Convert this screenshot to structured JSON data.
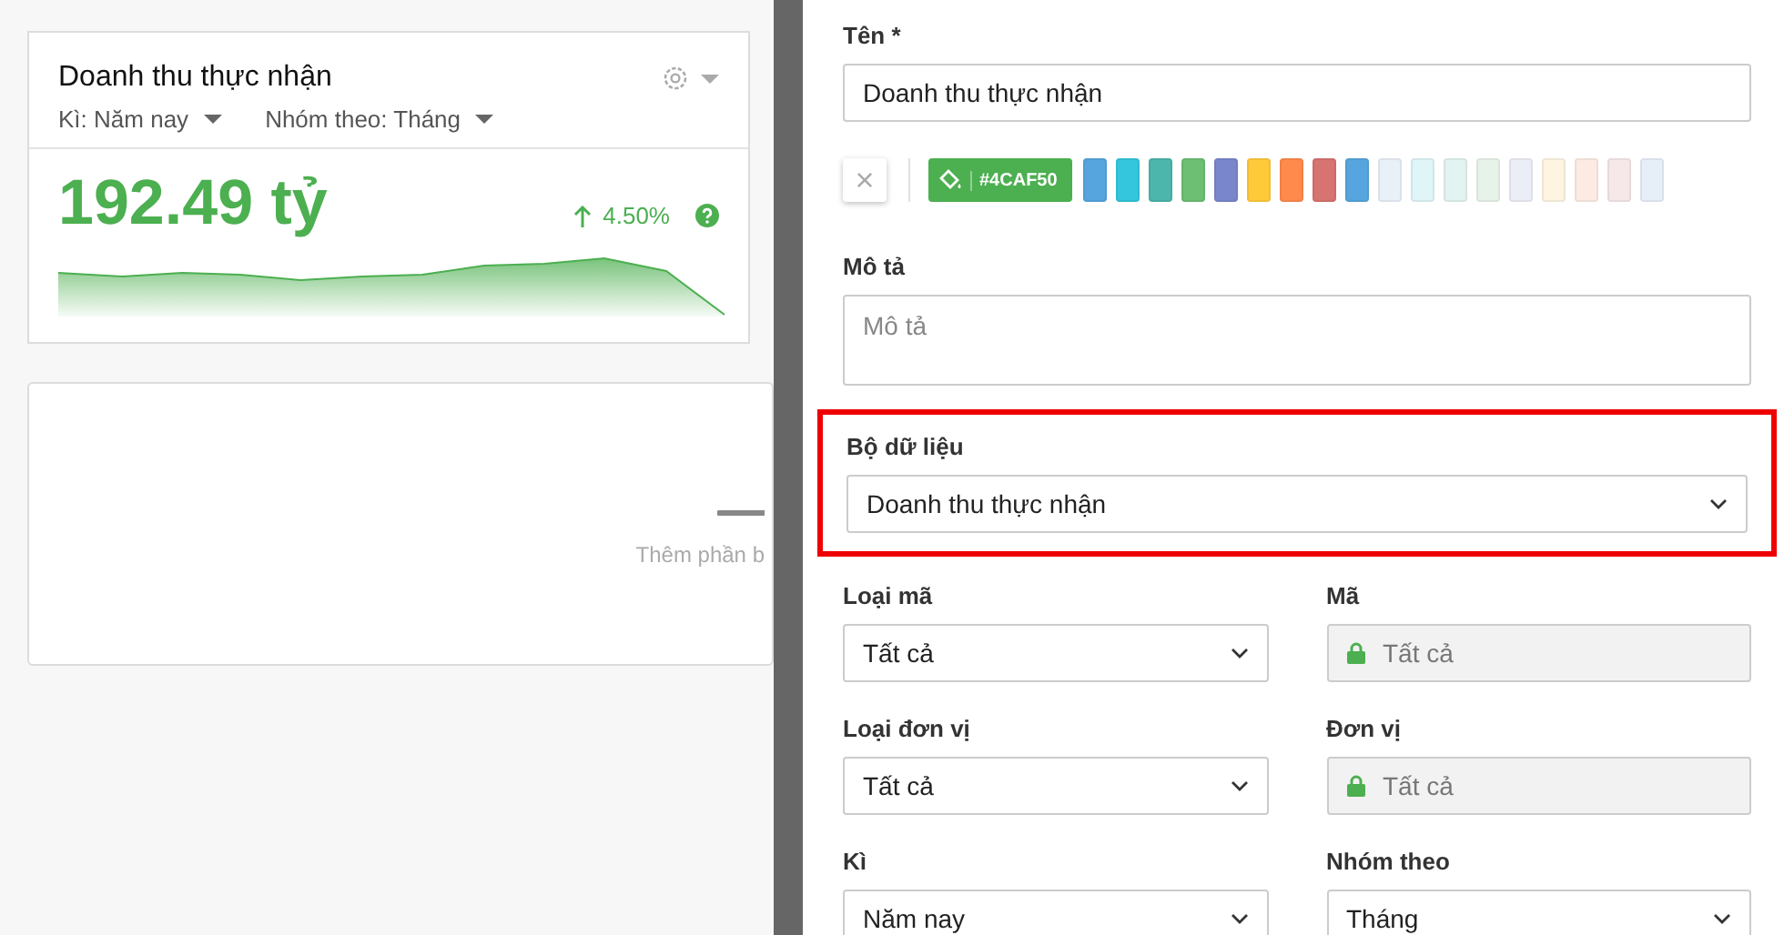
{
  "widget": {
    "title": "Doanh thu thực nhận",
    "filters": [
      {
        "label": "Kì:",
        "value": "Năm nay"
      },
      {
        "label": "Nhóm theo:",
        "value": "Tháng"
      }
    ],
    "value": "192.49 tỷ",
    "trend": {
      "text": "4.50%"
    }
  },
  "empty_card": {
    "hint": "Thêm phần b"
  },
  "drawer": {
    "name_field": {
      "label": "Tên *",
      "value": "Doanh thu thực nhận"
    },
    "color_picker": {
      "clear": "×",
      "current": "#4CAF50",
      "swatches": [
        {
          "color": "#57a5de"
        },
        {
          "color": "#33c6dc"
        },
        {
          "color": "#4db6ac"
        },
        {
          "color": "#6dbf73"
        },
        {
          "color": "#7986cb"
        },
        {
          "color": "#ffca3a"
        },
        {
          "color": "#ff8a4c"
        },
        {
          "color": "#d77370"
        },
        {
          "color": "#57a5de"
        },
        {
          "color": "#e8f0f8"
        },
        {
          "color": "#dff5f8"
        },
        {
          "color": "#e2f3f1"
        },
        {
          "color": "#e7f3e8"
        },
        {
          "color": "#eceef7"
        },
        {
          "color": "#fdf5e2"
        },
        {
          "color": "#fdebe3"
        },
        {
          "color": "#f6e8e8"
        },
        {
          "color": "#e6eff8"
        }
      ]
    },
    "description": {
      "label": "Mô tả",
      "placeholder": "Mô tả"
    },
    "dataset": {
      "label": "Bộ dữ liệu",
      "value": "Doanh thu thực nhận",
      "highlighted": true
    },
    "rows": [
      [
        {
          "label": "Loại mã",
          "value": "Tất cả",
          "kind": "select"
        },
        {
          "label": "Mã",
          "value": "Tất cả",
          "kind": "locked"
        }
      ],
      [
        {
          "label": "Loại đơn vị",
          "value": "Tất cả",
          "kind": "select"
        },
        {
          "label": "Đơn vị",
          "value": "Tất cả",
          "kind": "locked"
        }
      ],
      [
        {
          "label": "Kì",
          "value": "Năm nay",
          "kind": "select"
        },
        {
          "label": "Nhóm theo",
          "value": "Tháng",
          "kind": "select"
        }
      ]
    ]
  }
}
